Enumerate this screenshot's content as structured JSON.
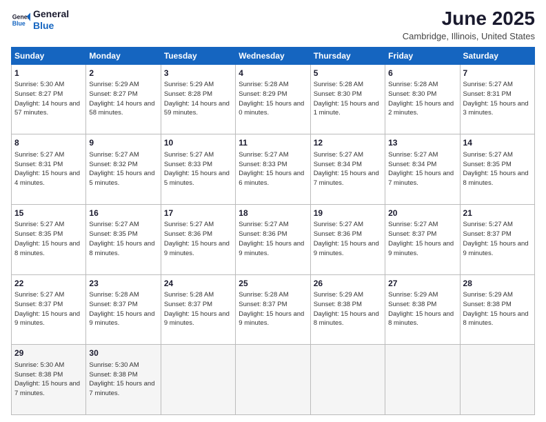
{
  "header": {
    "logo_line1": "General",
    "logo_line2": "Blue",
    "month_year": "June 2025",
    "location": "Cambridge, Illinois, United States"
  },
  "weekdays": [
    "Sunday",
    "Monday",
    "Tuesday",
    "Wednesday",
    "Thursday",
    "Friday",
    "Saturday"
  ],
  "weeks": [
    [
      {
        "day": "1",
        "sunrise": "Sunrise: 5:30 AM",
        "sunset": "Sunset: 8:27 PM",
        "daylight": "Daylight: 14 hours and 57 minutes."
      },
      {
        "day": "2",
        "sunrise": "Sunrise: 5:29 AM",
        "sunset": "Sunset: 8:27 PM",
        "daylight": "Daylight: 14 hours and 58 minutes."
      },
      {
        "day": "3",
        "sunrise": "Sunrise: 5:29 AM",
        "sunset": "Sunset: 8:28 PM",
        "daylight": "Daylight: 14 hours and 59 minutes."
      },
      {
        "day": "4",
        "sunrise": "Sunrise: 5:28 AM",
        "sunset": "Sunset: 8:29 PM",
        "daylight": "Daylight: 15 hours and 0 minutes."
      },
      {
        "day": "5",
        "sunrise": "Sunrise: 5:28 AM",
        "sunset": "Sunset: 8:30 PM",
        "daylight": "Daylight: 15 hours and 1 minute."
      },
      {
        "day": "6",
        "sunrise": "Sunrise: 5:28 AM",
        "sunset": "Sunset: 8:30 PM",
        "daylight": "Daylight: 15 hours and 2 minutes."
      },
      {
        "day": "7",
        "sunrise": "Sunrise: 5:27 AM",
        "sunset": "Sunset: 8:31 PM",
        "daylight": "Daylight: 15 hours and 3 minutes."
      }
    ],
    [
      {
        "day": "8",
        "sunrise": "Sunrise: 5:27 AM",
        "sunset": "Sunset: 8:31 PM",
        "daylight": "Daylight: 15 hours and 4 minutes."
      },
      {
        "day": "9",
        "sunrise": "Sunrise: 5:27 AM",
        "sunset": "Sunset: 8:32 PM",
        "daylight": "Daylight: 15 hours and 5 minutes."
      },
      {
        "day": "10",
        "sunrise": "Sunrise: 5:27 AM",
        "sunset": "Sunset: 8:33 PM",
        "daylight": "Daylight: 15 hours and 5 minutes."
      },
      {
        "day": "11",
        "sunrise": "Sunrise: 5:27 AM",
        "sunset": "Sunset: 8:33 PM",
        "daylight": "Daylight: 15 hours and 6 minutes."
      },
      {
        "day": "12",
        "sunrise": "Sunrise: 5:27 AM",
        "sunset": "Sunset: 8:34 PM",
        "daylight": "Daylight: 15 hours and 7 minutes."
      },
      {
        "day": "13",
        "sunrise": "Sunrise: 5:27 AM",
        "sunset": "Sunset: 8:34 PM",
        "daylight": "Daylight: 15 hours and 7 minutes."
      },
      {
        "day": "14",
        "sunrise": "Sunrise: 5:27 AM",
        "sunset": "Sunset: 8:35 PM",
        "daylight": "Daylight: 15 hours and 8 minutes."
      }
    ],
    [
      {
        "day": "15",
        "sunrise": "Sunrise: 5:27 AM",
        "sunset": "Sunset: 8:35 PM",
        "daylight": "Daylight: 15 hours and 8 minutes."
      },
      {
        "day": "16",
        "sunrise": "Sunrise: 5:27 AM",
        "sunset": "Sunset: 8:35 PM",
        "daylight": "Daylight: 15 hours and 8 minutes."
      },
      {
        "day": "17",
        "sunrise": "Sunrise: 5:27 AM",
        "sunset": "Sunset: 8:36 PM",
        "daylight": "Daylight: 15 hours and 9 minutes."
      },
      {
        "day": "18",
        "sunrise": "Sunrise: 5:27 AM",
        "sunset": "Sunset: 8:36 PM",
        "daylight": "Daylight: 15 hours and 9 minutes."
      },
      {
        "day": "19",
        "sunrise": "Sunrise: 5:27 AM",
        "sunset": "Sunset: 8:36 PM",
        "daylight": "Daylight: 15 hours and 9 minutes."
      },
      {
        "day": "20",
        "sunrise": "Sunrise: 5:27 AM",
        "sunset": "Sunset: 8:37 PM",
        "daylight": "Daylight: 15 hours and 9 minutes."
      },
      {
        "day": "21",
        "sunrise": "Sunrise: 5:27 AM",
        "sunset": "Sunset: 8:37 PM",
        "daylight": "Daylight: 15 hours and 9 minutes."
      }
    ],
    [
      {
        "day": "22",
        "sunrise": "Sunrise: 5:27 AM",
        "sunset": "Sunset: 8:37 PM",
        "daylight": "Daylight: 15 hours and 9 minutes."
      },
      {
        "day": "23",
        "sunrise": "Sunrise: 5:28 AM",
        "sunset": "Sunset: 8:37 PM",
        "daylight": "Daylight: 15 hours and 9 minutes."
      },
      {
        "day": "24",
        "sunrise": "Sunrise: 5:28 AM",
        "sunset": "Sunset: 8:37 PM",
        "daylight": "Daylight: 15 hours and 9 minutes."
      },
      {
        "day": "25",
        "sunrise": "Sunrise: 5:28 AM",
        "sunset": "Sunset: 8:37 PM",
        "daylight": "Daylight: 15 hours and 9 minutes."
      },
      {
        "day": "26",
        "sunrise": "Sunrise: 5:29 AM",
        "sunset": "Sunset: 8:38 PM",
        "daylight": "Daylight: 15 hours and 8 minutes."
      },
      {
        "day": "27",
        "sunrise": "Sunrise: 5:29 AM",
        "sunset": "Sunset: 8:38 PM",
        "daylight": "Daylight: 15 hours and 8 minutes."
      },
      {
        "day": "28",
        "sunrise": "Sunrise: 5:29 AM",
        "sunset": "Sunset: 8:38 PM",
        "daylight": "Daylight: 15 hours and 8 minutes."
      }
    ],
    [
      {
        "day": "29",
        "sunrise": "Sunrise: 5:30 AM",
        "sunset": "Sunset: 8:38 PM",
        "daylight": "Daylight: 15 hours and 7 minutes."
      },
      {
        "day": "30",
        "sunrise": "Sunrise: 5:30 AM",
        "sunset": "Sunset: 8:38 PM",
        "daylight": "Daylight: 15 hours and 7 minutes."
      },
      null,
      null,
      null,
      null,
      null
    ]
  ]
}
